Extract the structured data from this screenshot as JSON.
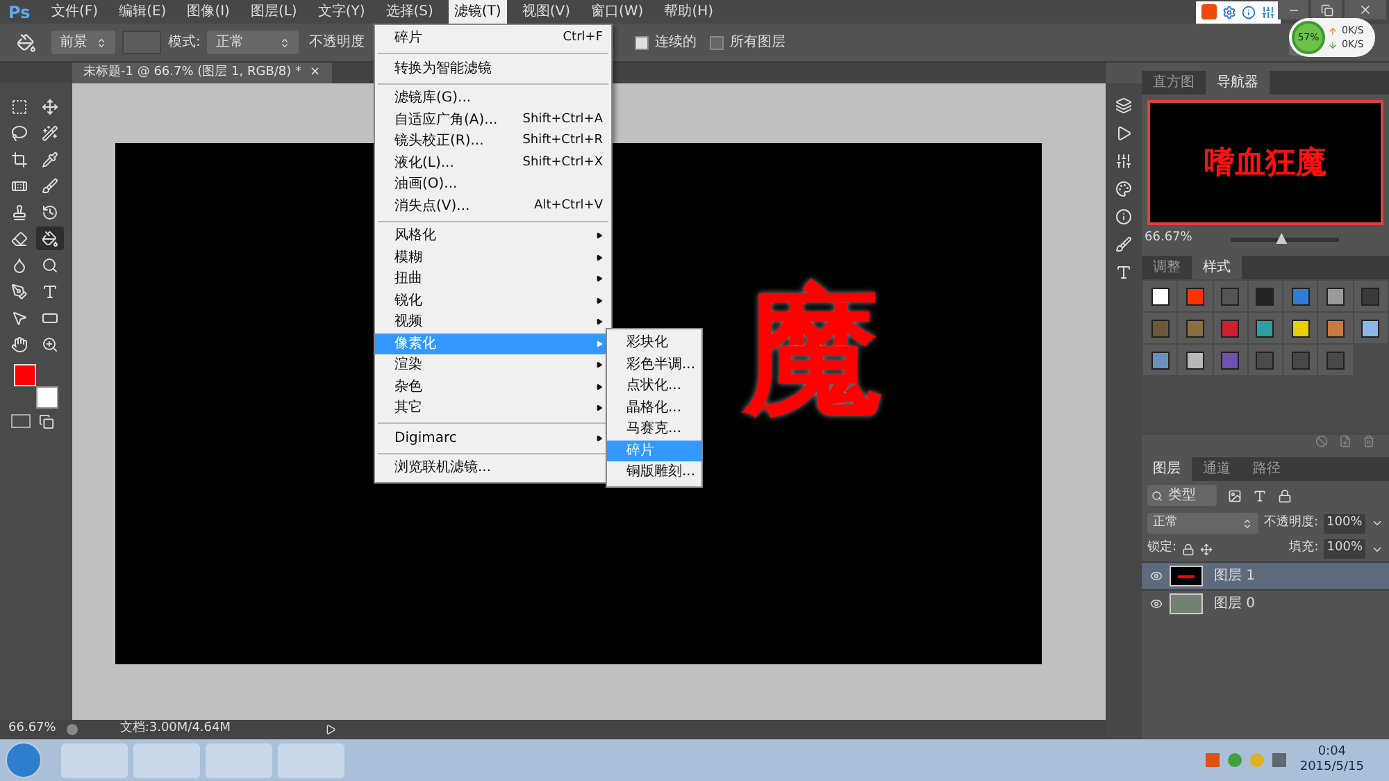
{
  "menu_bar": {
    "logo": "Ps",
    "items": [
      {
        "label": "文件(F)",
        "selected": false
      },
      {
        "label": "编辑(E)",
        "selected": false
      },
      {
        "label": "图像(I)",
        "selected": false
      },
      {
        "label": "图层(L)",
        "selected": false
      },
      {
        "label": "文字(Y)",
        "selected": false
      },
      {
        "label": "选择(S)",
        "selected": false
      },
      {
        "label": "滤镜(T)",
        "selected": true
      },
      {
        "label": "视图(V)",
        "selected": false
      },
      {
        "label": "窗口(W)",
        "selected": false
      },
      {
        "label": "帮助(H)",
        "selected": false
      }
    ]
  },
  "options_bar": {
    "fill_source": "前景",
    "mode_label": "模式:",
    "mode": "正常",
    "opacity_label": "不透明度",
    "contiguous": {
      "label": "连续的",
      "checked": true
    },
    "all_layers": {
      "label": "所有图层",
      "checked": false
    }
  },
  "network_widget": {
    "percent": "57%",
    "upload": "0K/S",
    "download": "0K/S"
  },
  "document_tab": {
    "title": "未标题-1 @ 66.7% (图层 1, RGB/8) *",
    "close": "×"
  },
  "tools": [
    {
      "kind": "marquee",
      "selected": false
    },
    {
      "kind": "move",
      "selected": false
    },
    {
      "kind": "lasso",
      "selected": false
    },
    {
      "kind": "wand",
      "selected": false
    },
    {
      "kind": "crop",
      "selected": false
    },
    {
      "kind": "eyedropper",
      "selected": false
    },
    {
      "kind": "heal",
      "selected": false
    },
    {
      "kind": "brush",
      "selected": false
    },
    {
      "kind": "stamp",
      "selected": false
    },
    {
      "kind": "history",
      "selected": false
    },
    {
      "kind": "eraser",
      "selected": false
    },
    {
      "kind": "bucket",
      "selected": true
    },
    {
      "kind": "blur",
      "selected": false
    },
    {
      "kind": "dodge",
      "selected": false
    },
    {
      "kind": "pen",
      "selected": false
    },
    {
      "kind": "type",
      "selected": false
    },
    {
      "kind": "select",
      "selected": false
    },
    {
      "kind": "shape",
      "selected": false
    },
    {
      "kind": "hand",
      "selected": false
    },
    {
      "kind": "zoom",
      "selected": false
    }
  ],
  "canvas_text": "魔",
  "filter_menu": {
    "items": [
      {
        "kind": "item",
        "label": "碎片",
        "shortcut": "Ctrl+F",
        "selected": false
      },
      {
        "kind": "separator"
      },
      {
        "kind": "item",
        "label": "转换为智能滤镜",
        "selected": false
      },
      {
        "kind": "separator"
      },
      {
        "kind": "item",
        "label": "滤镜库(G)...",
        "selected": false
      },
      {
        "kind": "item",
        "label": "自适应广角(A)...",
        "shortcut": "Shift+Ctrl+A",
        "selected": false
      },
      {
        "kind": "item",
        "label": "镜头校正(R)...",
        "shortcut": "Shift+Ctrl+R",
        "selected": false
      },
      {
        "kind": "item",
        "label": "液化(L)...",
        "shortcut": "Shift+Ctrl+X",
        "selected": false
      },
      {
        "kind": "item",
        "label": "油画(O)...",
        "selected": false
      },
      {
        "kind": "item",
        "label": "消失点(V)...",
        "shortcut": "Alt+Ctrl+V",
        "selected": false
      },
      {
        "kind": "separator"
      },
      {
        "kind": "submenu",
        "label": "风格化",
        "selected": false
      },
      {
        "kind": "submenu",
        "label": "模糊",
        "selected": false
      },
      {
        "kind": "submenu",
        "label": "扭曲",
        "selected": false
      },
      {
        "kind": "submenu",
        "label": "锐化",
        "selected": false
      },
      {
        "kind": "submenu",
        "label": "视频",
        "selected": false
      },
      {
        "kind": "submenu",
        "label": "像素化",
        "selected": true
      },
      {
        "kind": "submenu",
        "label": "渲染",
        "selected": false
      },
      {
        "kind": "submenu",
        "label": "杂色",
        "selected": false
      },
      {
        "kind": "submenu",
        "label": "其它",
        "selected": false
      },
      {
        "kind": "separator"
      },
      {
        "kind": "submenu",
        "label": "Digimarc",
        "selected": false
      },
      {
        "kind": "separator"
      },
      {
        "kind": "item",
        "label": "浏览联机滤镜...",
        "selected": false
      }
    ]
  },
  "pixelate_submenu": [
    {
      "label": "彩块化",
      "selected": false
    },
    {
      "label": "彩色半调...",
      "selected": false
    },
    {
      "label": "点状化...",
      "selected": false
    },
    {
      "label": "晶格化...",
      "selected": false
    },
    {
      "label": "马赛克...",
      "selected": false
    },
    {
      "label": "碎片",
      "selected": true
    },
    {
      "label": "铜版雕刻...",
      "selected": false
    }
  ],
  "navigator_panel": {
    "tabs": [
      {
        "label": "直方图",
        "selected": false
      },
      {
        "label": "导航器",
        "selected": true
      }
    ],
    "preview_text": "嗜血狂魔",
    "zoom": "66.67%",
    "zoom_slider": {
      "level": 0.47
    }
  },
  "styles_panel": {
    "tabs": [
      {
        "label": "调整",
        "selected": false
      },
      {
        "label": "样式",
        "selected": true
      }
    ],
    "swatches": [
      {
        "color": "#ffffff"
      },
      {
        "color": "#ff3300"
      },
      {
        "color": "#555555"
      },
      {
        "color": "#222222"
      },
      {
        "color": "#2f7fd6"
      },
      {
        "color": "#9a9a9a"
      },
      {
        "color": "#3a3a3a"
      },
      {
        "color": "#6b5a35"
      },
      {
        "color": "#8a7040"
      },
      {
        "color": "#d02030"
      },
      {
        "color": "#2aa0a0"
      },
      {
        "color": "#e8d000"
      },
      {
        "color": "#c87a40"
      },
      {
        "color": "#8ab8e8"
      },
      {
        "color": "#6a90c0"
      },
      {
        "color": "#b8b8b8"
      },
      {
        "color": "#7050b0"
      },
      {
        "color": "#4a4a4a"
      },
      {
        "color": "#474747"
      },
      {
        "color": "#484848"
      }
    ]
  },
  "layers_panel": {
    "tabs": [
      {
        "label": "图层",
        "selected": true
      },
      {
        "label": "通道",
        "selected": false
      },
      {
        "label": "路径",
        "selected": false
      }
    ],
    "filter": "类型",
    "blend_mode": "正常",
    "opacity_label": "不透明度:",
    "opacity": "100%",
    "lock_label": "锁定:",
    "fill_label": "填充:",
    "fill": "100%",
    "layers": [
      {
        "name": "图层 1",
        "visible": true,
        "selected": true,
        "kind": "text"
      },
      {
        "name": "图层 0",
        "visible": true,
        "selected": false,
        "kind": "fill"
      }
    ]
  },
  "status_bar": {
    "zoom": "66.67%",
    "document": "文档:3.00M/4.64M"
  },
  "taskbar": {
    "time": "0:04",
    "date": "2015/5/15"
  }
}
